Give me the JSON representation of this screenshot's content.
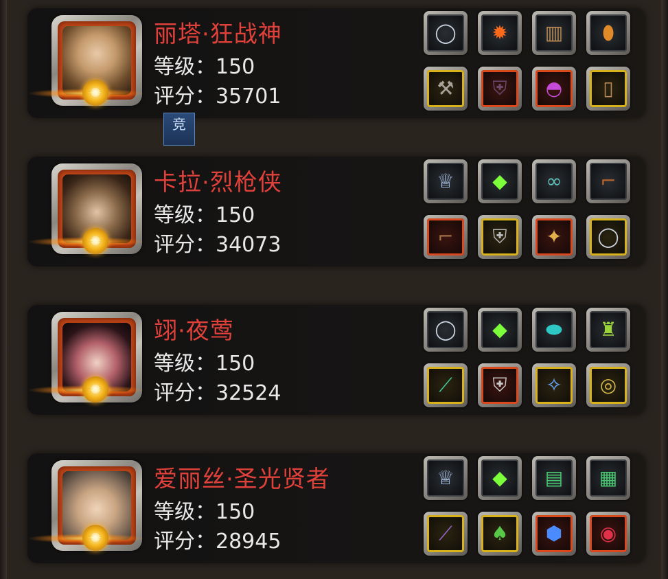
{
  "labels": {
    "level": "等级",
    "score": "评分",
    "separator": "："
  },
  "arena_tag": "竞",
  "heroes": [
    {
      "name": "丽塔·狂战神",
      "level": "150",
      "score": "35701",
      "equipment": [
        {
          "icon": "silver-ring-icon",
          "quality": "common"
        },
        {
          "icon": "fire-orb-icon",
          "quality": "common"
        },
        {
          "icon": "barrel-icon",
          "quality": "common"
        },
        {
          "icon": "amber-potion-icon",
          "quality": "common"
        },
        {
          "icon": "battle-axe-icon",
          "quality": "gold"
        },
        {
          "icon": "dark-armor-icon",
          "quality": "red"
        },
        {
          "icon": "purple-helmet-icon",
          "quality": "red"
        },
        {
          "icon": "leg-guard-icon",
          "quality": "gold"
        }
      ]
    },
    {
      "name": "卡拉·烈枪侠",
      "level": "150",
      "score": "34073",
      "equipment": [
        {
          "icon": "frost-crown-icon",
          "quality": "common"
        },
        {
          "icon": "green-crystal-icon",
          "quality": "common"
        },
        {
          "icon": "goggles-icon",
          "quality": "common"
        },
        {
          "icon": "smoking-pipe-icon",
          "quality": "common"
        },
        {
          "icon": "pistol-icon",
          "quality": "red"
        },
        {
          "icon": "steel-armor-icon",
          "quality": "gold"
        },
        {
          "icon": "amulet-icon",
          "quality": "red"
        },
        {
          "icon": "silver-ring-icon",
          "quality": "gold"
        }
      ]
    },
    {
      "name": "翊·夜莺",
      "level": "150",
      "score": "32524",
      "equipment": [
        {
          "icon": "silver-ring-icon",
          "quality": "common"
        },
        {
          "icon": "green-crystal-icon",
          "quality": "common"
        },
        {
          "icon": "teal-gem-icon",
          "quality": "common"
        },
        {
          "icon": "lantern-icon",
          "quality": "common"
        },
        {
          "icon": "curved-blade-icon",
          "quality": "gold"
        },
        {
          "icon": "spiked-armor-icon",
          "quality": "red"
        },
        {
          "icon": "pendant-icon",
          "quality": "gold"
        },
        {
          "icon": "gold-ring-icon",
          "quality": "gold"
        }
      ]
    },
    {
      "name": "爱丽丝·圣光贤者",
      "level": "150",
      "score": "28945",
      "equipment": [
        {
          "icon": "frost-crown-icon",
          "quality": "common"
        },
        {
          "icon": "green-crystal-icon",
          "quality": "common"
        },
        {
          "icon": "green-scroll-icon",
          "quality": "common"
        },
        {
          "icon": "green-tankard-icon",
          "quality": "common"
        },
        {
          "icon": "magic-staff-icon",
          "quality": "gold"
        },
        {
          "icon": "green-robe-icon",
          "quality": "gold"
        },
        {
          "icon": "blue-gem-icon",
          "quality": "red"
        },
        {
          "icon": "ruby-ring-icon",
          "quality": "red"
        }
      ]
    }
  ]
}
